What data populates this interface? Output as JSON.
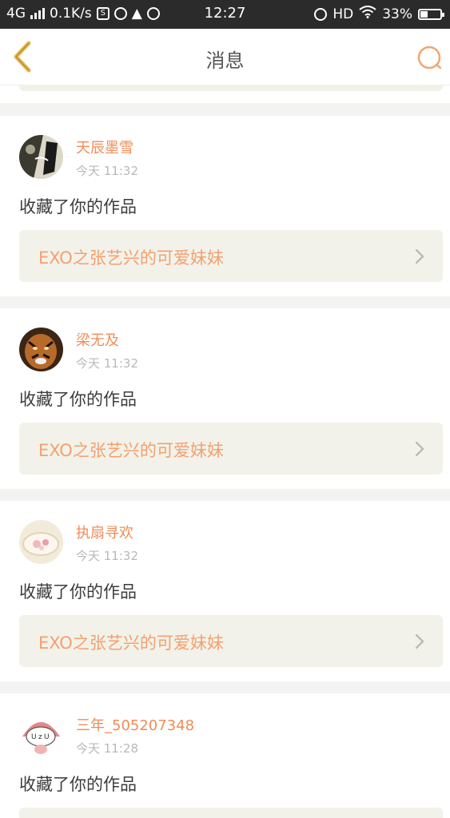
{
  "status_bar": {
    "network": "4G",
    "speed": "0.1K/s",
    "time": "12:27",
    "hd": "HD",
    "battery_percent": "33%",
    "battery_level": 0.33
  },
  "header": {
    "title": "消息"
  },
  "colors": {
    "accent": "#f08c57",
    "back_icon": "#e8b84a",
    "card_bg": "#f2f2ea"
  },
  "messages": [
    {
      "name": "天辰墨雪",
      "time": "今天 11:32",
      "action": "收藏了你的作品",
      "work_title": "EXO之张艺兴的可爱妹妹"
    },
    {
      "name": "梁无及",
      "time": "今天 11:32",
      "action": "收藏了你的作品",
      "work_title": "EXO之张艺兴的可爱妹妹"
    },
    {
      "name": "执扇寻欢",
      "time": "今天 11:32",
      "action": "收藏了你的作品",
      "work_title": "EXO之张艺兴的可爱妹妹"
    },
    {
      "name": "三年_505207348",
      "time": "今天 11:28",
      "action": "收藏了你的作品",
      "work_title": ""
    }
  ]
}
